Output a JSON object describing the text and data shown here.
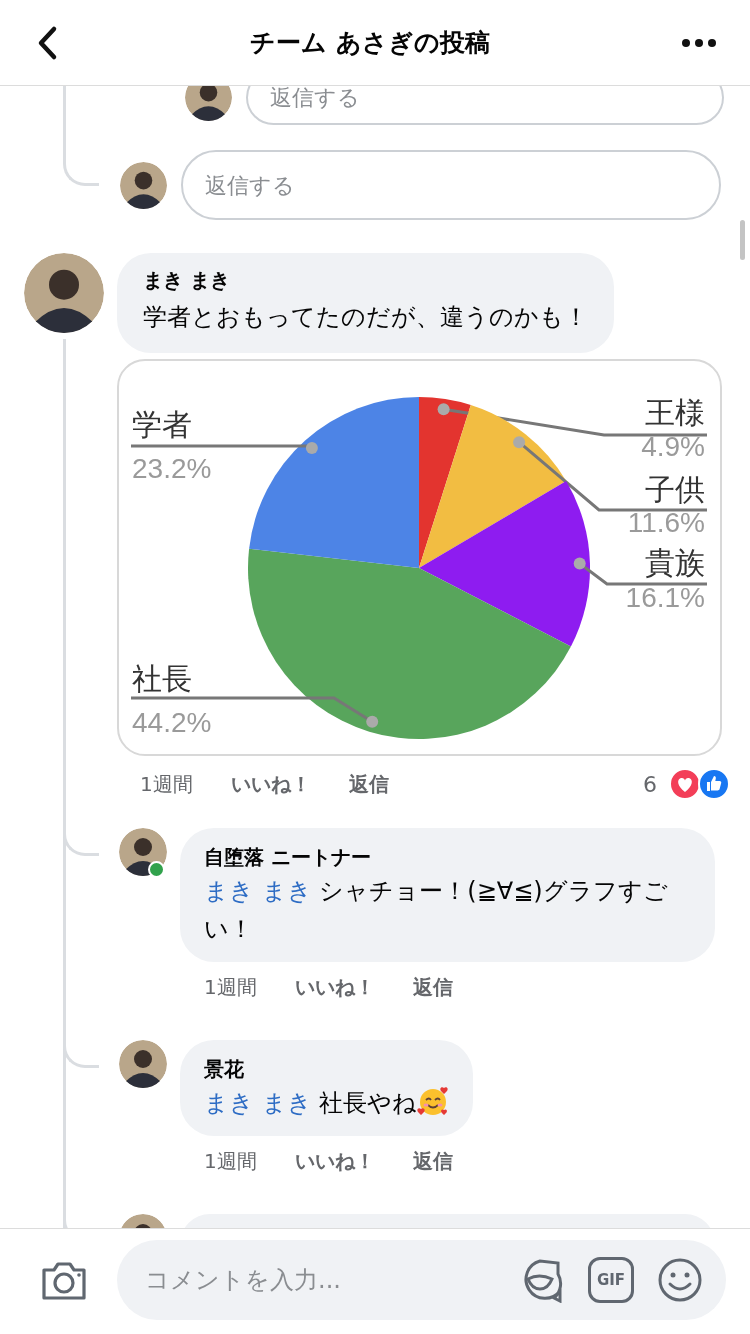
{
  "header": {
    "title": "チーム あさぎの投稿"
  },
  "reply_fields": [
    {
      "placeholder": "返信する",
      "nested": true
    },
    {
      "placeholder": "返信する",
      "nested": false
    }
  ],
  "comment": {
    "author": "まき まき",
    "text": "学者とおもってたのだが、違うのかも！",
    "chart_data": {
      "type": "pie",
      "categories": [
        "王様",
        "子供",
        "貴族",
        "社長",
        "学者"
      ],
      "series": [
        {
          "values": [
            4.9,
            11.6,
            16.1,
            44.2,
            23.2
          ]
        }
      ],
      "colors": [
        "#e3342f",
        "#f2bd42",
        "#8e1cf0",
        "#58a55c",
        "#4d84e6"
      ],
      "value_labels": [
        "4.9%",
        "11.6%",
        "16.1%",
        "44.2%",
        "23.2%"
      ]
    },
    "time": "1週間",
    "like": "いいね！",
    "reply": "返信",
    "reaction_count": "6",
    "reactions": [
      {
        "kind": "love"
      },
      {
        "kind": "like"
      }
    ],
    "replies": [
      {
        "kind": "full",
        "author": "自堕落 ニートナー",
        "online": true,
        "mention": "まき まき",
        "text": "シャチョー！(≧∀≦)グラフすごい！",
        "emoji": false,
        "time": "1週間",
        "like": "いいね！",
        "reply": "返信"
      },
      {
        "kind": "full",
        "author": "景花",
        "online": false,
        "mention": "まき まき",
        "text": "社長やね",
        "emoji": true,
        "time": "1週間",
        "like": "いいね！",
        "reply": "返信"
      },
      {
        "kind": "clipped",
        "online": false
      }
    ]
  },
  "composer": {
    "placeholder": "コメントを入力...",
    "gif_label": "GIF"
  }
}
